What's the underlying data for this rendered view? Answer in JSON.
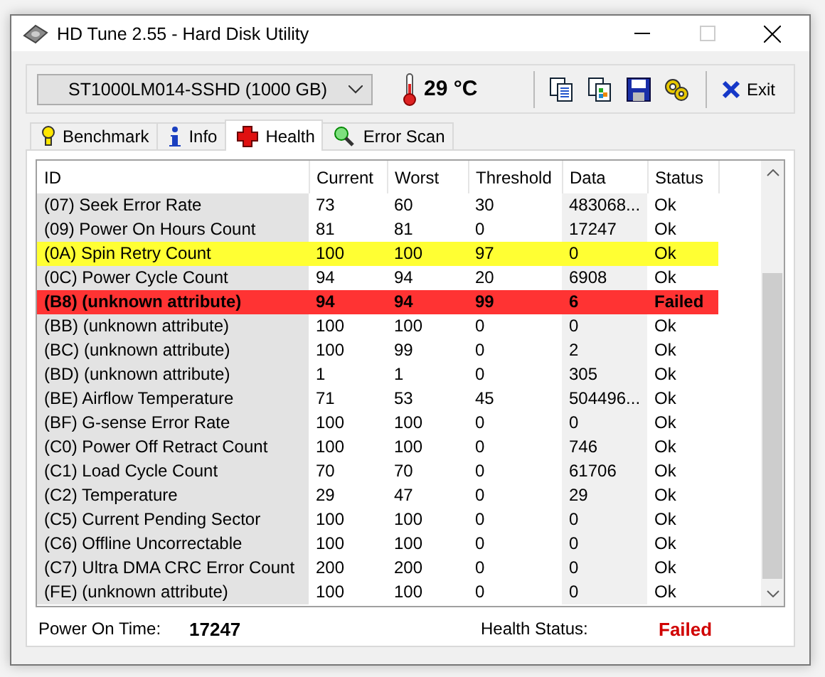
{
  "window": {
    "title": "HD Tune 2.55 - Hard Disk Utility"
  },
  "toolbar": {
    "drive": "ST1000LM014-SSHD (1000 GB)",
    "temperature": "29 °C",
    "exit": "Exit"
  },
  "tabs": [
    {
      "label": "Benchmark",
      "selected": false
    },
    {
      "label": "Info",
      "selected": false
    },
    {
      "label": "Health",
      "selected": true
    },
    {
      "label": "Error Scan",
      "selected": false
    }
  ],
  "table": {
    "columns": [
      "ID",
      "Current",
      "Worst",
      "Threshold",
      "Data",
      "Status"
    ],
    "rows": [
      {
        "cells": [
          "(07) Seek Error Rate",
          "73",
          "60",
          "30",
          "483068...",
          "Ok"
        ],
        "kind": "normal"
      },
      {
        "cells": [
          "(09) Power On Hours Count",
          "81",
          "81",
          "0",
          "17247",
          "Ok"
        ],
        "kind": "normal"
      },
      {
        "cells": [
          "(0A) Spin Retry Count",
          "100",
          "100",
          "97",
          "0",
          "Ok"
        ],
        "kind": "warning"
      },
      {
        "cells": [
          "(0C) Power Cycle Count",
          "94",
          "94",
          "20",
          "6908",
          "Ok"
        ],
        "kind": "normal"
      },
      {
        "cells": [
          "(B8) (unknown attribute)",
          "94",
          "94",
          "99",
          "6",
          "Failed"
        ],
        "kind": "failed"
      },
      {
        "cells": [
          "(BB) (unknown attribute)",
          "100",
          "100",
          "0",
          "0",
          "Ok"
        ],
        "kind": "normal"
      },
      {
        "cells": [
          "(BC) (unknown attribute)",
          "100",
          "99",
          "0",
          "2",
          "Ok"
        ],
        "kind": "normal"
      },
      {
        "cells": [
          "(BD) (unknown attribute)",
          "1",
          "1",
          "0",
          "305",
          "Ok"
        ],
        "kind": "normal"
      },
      {
        "cells": [
          "(BE) Airflow Temperature",
          "71",
          "53",
          "45",
          "504496...",
          "Ok"
        ],
        "kind": "normal"
      },
      {
        "cells": [
          "(BF) G-sense Error Rate",
          "100",
          "100",
          "0",
          "0",
          "Ok"
        ],
        "kind": "normal"
      },
      {
        "cells": [
          "(C0) Power Off Retract Count",
          "100",
          "100",
          "0",
          "746",
          "Ok"
        ],
        "kind": "normal"
      },
      {
        "cells": [
          "(C1) Load Cycle Count",
          "70",
          "70",
          "0",
          "61706",
          "Ok"
        ],
        "kind": "normal"
      },
      {
        "cells": [
          "(C2) Temperature",
          "29",
          "47",
          "0",
          "29",
          "Ok"
        ],
        "kind": "normal"
      },
      {
        "cells": [
          "(C5) Current Pending Sector",
          "100",
          "100",
          "0",
          "0",
          "Ok"
        ],
        "kind": "normal"
      },
      {
        "cells": [
          "(C6) Offline Uncorrectable",
          "100",
          "100",
          "0",
          "0",
          "Ok"
        ],
        "kind": "normal"
      },
      {
        "cells": [
          "(C7) Ultra DMA CRC Error Count",
          "200",
          "200",
          "0",
          "0",
          "Ok"
        ],
        "kind": "normal"
      },
      {
        "cells": [
          "(FE) (unknown attribute)",
          "100",
          "100",
          "0",
          "0",
          "Ok"
        ],
        "kind": "normal"
      }
    ]
  },
  "status_bar": {
    "power_on_label": "Power On Time:",
    "power_on_value": "17247",
    "health_label": "Health Status:",
    "health_value": "Failed",
    "health_failed": true
  }
}
